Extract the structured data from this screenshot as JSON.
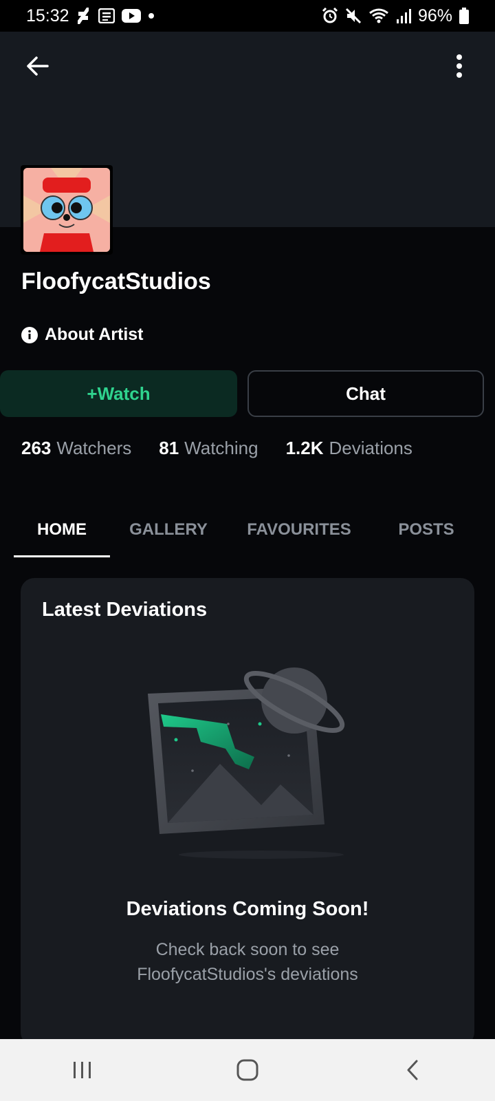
{
  "status_bar": {
    "time": "15:32",
    "battery": "96%"
  },
  "profile": {
    "username": "FloofycatStudios",
    "about_label": "About Artist"
  },
  "actions": {
    "watch_label": "+Watch",
    "chat_label": "Chat"
  },
  "stats": [
    {
      "value": "263",
      "label": "Watchers"
    },
    {
      "value": "81",
      "label": "Watching"
    },
    {
      "value": "1.2K",
      "label": "Deviations"
    }
  ],
  "tabs": [
    {
      "label": "HOME",
      "active": true
    },
    {
      "label": "GALLERY",
      "active": false
    },
    {
      "label": "FAVOURITES",
      "active": false
    },
    {
      "label": "POSTS",
      "active": false
    }
  ],
  "latest": {
    "title": "Latest Deviations",
    "empty_title": "Deviations Coming Soon!",
    "empty_line1": "Check back soon to see",
    "empty_line2": "FloofycatStudios's deviations"
  },
  "colors": {
    "accent": "#2fd38e",
    "background": "#06070a",
    "card": "#181b20"
  }
}
